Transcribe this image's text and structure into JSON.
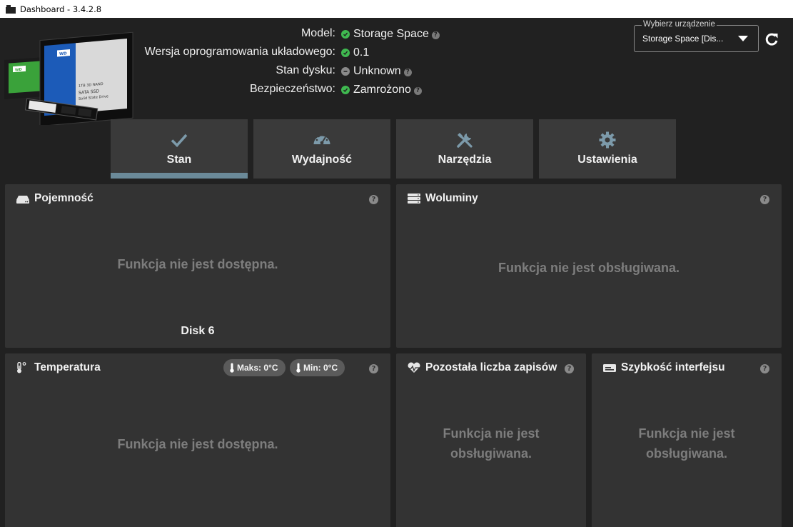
{
  "window": {
    "title": "Dashboard - 3.4.2.8"
  },
  "device_info": {
    "model_label": "Model:",
    "model_value": "Storage Space",
    "firmware_label": "Wersja oprogramowania układowego:",
    "firmware_value": "0.1",
    "disk_state_label": "Stan dysku:",
    "disk_state_value": "Unknown",
    "security_label": "Bezpieczeństwo:",
    "security_value": "Zamrożono"
  },
  "device_select": {
    "legend": "Wybierz urządzenie",
    "value": "Storage Space [Dis..."
  },
  "tabs": [
    {
      "label": "Stan",
      "icon": "checkmark-icon",
      "active": true
    },
    {
      "label": "Wydajność",
      "icon": "speedometer-icon",
      "active": false
    },
    {
      "label": "Narzędzia",
      "icon": "tools-icon",
      "active": false
    },
    {
      "label": "Ustawienia",
      "icon": "gear-icon",
      "active": false
    }
  ],
  "panels": {
    "capacity": {
      "title": "Pojemność",
      "message": "Funkcja nie jest dostępna.",
      "disk_label": "Disk 6"
    },
    "volumes": {
      "title": "Woluminy",
      "message": "Funkcja nie jest obsługiwana."
    },
    "temperature": {
      "title": "Temperatura",
      "max_label": "Maks: 0°C",
      "min_label": "Min: 0°C",
      "message": "Funkcja nie jest dostępna."
    },
    "writes": {
      "title": "Pozostała liczba zapisów",
      "message_line1": "Funkcja nie jest",
      "message_line2": "obsługiwana."
    },
    "interface": {
      "title": "Szybkość interfejsu",
      "message_line1": "Funkcja nie jest",
      "message_line2": "obsługiwana."
    }
  },
  "colors": {
    "ok_green": "#3fb950",
    "unknown_gray": "#8a8a8a",
    "accent_tab": "#6b8a99",
    "icon_blue": "#7c9aaa"
  },
  "help_glyph": "?"
}
